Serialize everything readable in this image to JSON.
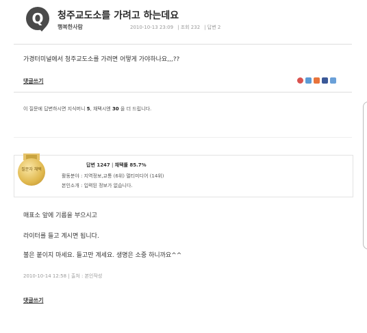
{
  "question": {
    "icon_letter": "Q",
    "title": "청주교도소를 가려고 하는데요",
    "author": "행복한사람",
    "date": "2010-10-13 23:09",
    "views": "조회 232",
    "answers": "답변 2",
    "text": "가경터미널에서 청주교도소를 가려면 어떻게 가야하나요,,,??"
  },
  "reply_label": "댓글쓰기",
  "share_icons": [
    "#d9534f",
    "#5b9bd5",
    "#e8743b",
    "#3b5998",
    "#6aa0d8"
  ],
  "notice": {
    "prefix": "이 질문에 답변하시면 지식머니 ",
    "money": "5",
    "middle": ", 채택시엔 ",
    "bonus": "30",
    "suffix": " 을 더 드립니다."
  },
  "answerer": {
    "medal_text": "질문자 채택",
    "answer_count": "답변 1247",
    "adopt_rate": "채택률 85.7%",
    "field": "활동분야 : 지역정보,교통 (6위)  멀티미디어 (14위)",
    "intro": "본인소개 : 입력된 정보가 없습니다."
  },
  "answer": {
    "line1": "매표소 앞에 기름을 부으시고",
    "line2": "라이터를 들고 계시면 됩니다.",
    "line3": "불은 붙이지 마세요. 들고만 계세요. 생명은 소중 하니까요^^",
    "date": "2010-10-14 12:58",
    "source": "출처 : 본인작성"
  }
}
